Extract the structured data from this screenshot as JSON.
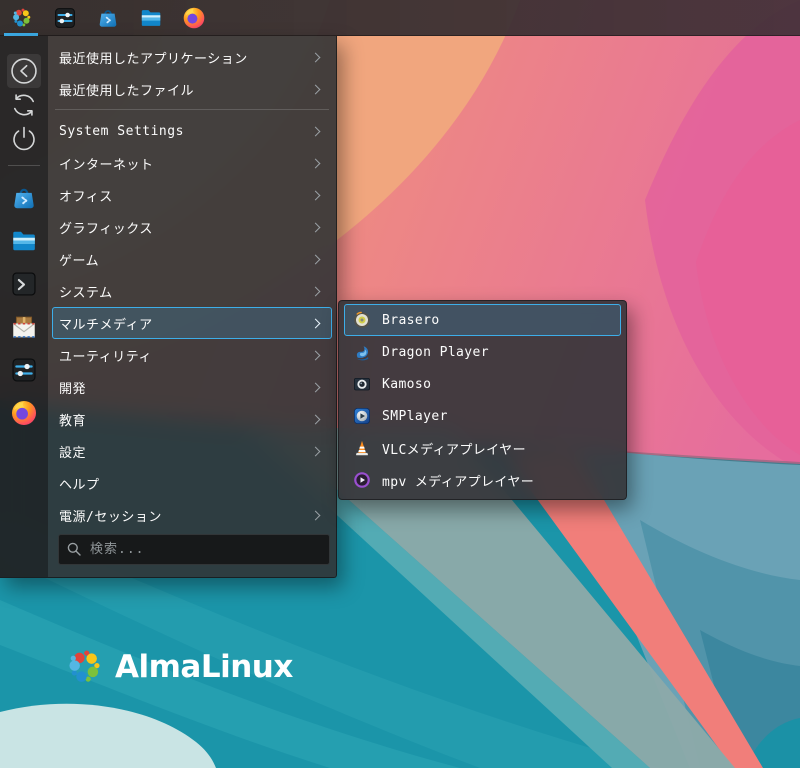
{
  "colors": {
    "accent": "#3daee9",
    "panel_bg": "#2f2b2b",
    "menu_bg": "#333537",
    "wallpaper_teal": "#1b95a9",
    "wallpaper_pink": "#e8739d"
  },
  "taskbar": {
    "buttons": [
      {
        "icon": "almalinux-launcher-icon",
        "active": true
      },
      {
        "icon": "system-settings-icon"
      },
      {
        "icon": "discover-icon"
      },
      {
        "icon": "file-manager-icon"
      },
      {
        "icon": "firefox-icon"
      }
    ]
  },
  "launcher_menu": {
    "sidebar": {
      "actions": [
        {
          "icon": "back-icon"
        },
        {
          "icon": "restart-icon"
        },
        {
          "icon": "shutdown-icon"
        }
      ],
      "favorites": [
        {
          "icon": "discover-icon"
        },
        {
          "icon": "file-manager-icon"
        },
        {
          "icon": "konsole-icon"
        },
        {
          "icon": "kontact-mail-icon"
        },
        {
          "icon": "system-settings-icon"
        },
        {
          "icon": "firefox-icon"
        }
      ]
    },
    "categories": [
      {
        "label": "最近使用したアプリケーション",
        "has_submenu": true
      },
      {
        "label": "最近使用したファイル",
        "has_submenu": true
      },
      {
        "label": "System Settings",
        "has_submenu": true
      },
      {
        "label": "インターネット",
        "has_submenu": true
      },
      {
        "label": "オフィス",
        "has_submenu": true
      },
      {
        "label": "グラフィックス",
        "has_submenu": true
      },
      {
        "label": "ゲーム",
        "has_submenu": true
      },
      {
        "label": "システム",
        "has_submenu": true
      },
      {
        "label": "マルチメディア",
        "has_submenu": true,
        "selected": true
      },
      {
        "label": "ユーティリティ",
        "has_submenu": true
      },
      {
        "label": "開発",
        "has_submenu": true
      },
      {
        "label": "教育",
        "has_submenu": true
      },
      {
        "label": "設定",
        "has_submenu": true
      },
      {
        "label": "ヘルプ",
        "has_submenu": false
      },
      {
        "label": "電源/セッション",
        "has_submenu": true
      }
    ],
    "search": {
      "placeholder": "検索..."
    }
  },
  "submenu": {
    "items": [
      {
        "label": "Brasero",
        "icon": "brasero-icon",
        "selected": true
      },
      {
        "label": "Dragon Player",
        "icon": "dragon-player-icon"
      },
      {
        "label": "Kamoso",
        "icon": "kamoso-icon"
      },
      {
        "label": "SMPlayer",
        "icon": "smplayer-icon"
      },
      {
        "label": "VLCメディアプレイヤー",
        "icon": "vlc-icon"
      },
      {
        "label": "mpv メディアプレイヤー",
        "icon": "mpv-icon"
      }
    ]
  },
  "desktop": {
    "logo_text": "AlmaLinux"
  }
}
